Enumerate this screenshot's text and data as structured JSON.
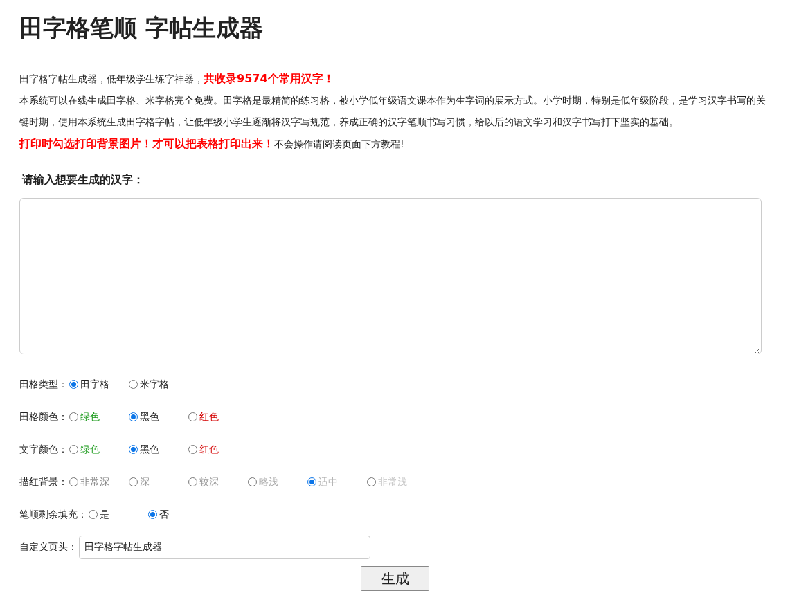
{
  "title": "田字格笔顺 字帖生成器",
  "intro": [
    {
      "parts": [
        {
          "text": "田字格字帖生成器，低年级学生练字神器，",
          "emphasis": false
        },
        {
          "text": "共收录9574个常用汉字！",
          "emphasis": true
        }
      ]
    },
    {
      "parts": [
        {
          "text": "本系统可以在线生成田字格、米字格完全免费。田字格是最精简的练习格，被小学低年级语文课本作为生字词的展示方式。小学时期，特别是低年级阶段，是学习汉字书写的关键时期，使用本系统生成田字格字帖，让低年级小学生逐渐将汉字写规范，养成正确的汉字笔顺书写习惯，给以后的语文学习和汉字书写打下坚实的基础。",
          "emphasis": false
        }
      ]
    },
    {
      "parts": [
        {
          "text": "打印时勾选打印背景图片！才可以把表格打印出来！",
          "emphasis": true
        },
        {
          "text": "不会操作请阅读页面下方教程!",
          "emphasis": false
        }
      ]
    }
  ],
  "input_label": "请输入想要生成的汉字：",
  "option_groups": [
    {
      "label": "田格类型：",
      "options": [
        {
          "label": "田字格",
          "selected": true
        },
        {
          "label": "米字格",
          "selected": false
        }
      ]
    },
    {
      "label": "田格颜色：",
      "options": [
        {
          "label": "绿色",
          "selected": false,
          "color": "#1a9a1a"
        },
        {
          "label": "黑色",
          "selected": true,
          "color": "#222222"
        },
        {
          "label": "红色",
          "selected": false,
          "color": "#d40000"
        }
      ]
    },
    {
      "label": "文字颜色：",
      "options": [
        {
          "label": "绿色",
          "selected": false,
          "color": "#1a9a1a"
        },
        {
          "label": "黑色",
          "selected": true,
          "color": "#222222"
        },
        {
          "label": "红色",
          "selected": false,
          "color": "#d40000"
        }
      ]
    },
    {
      "label": "描红背景：",
      "options": [
        {
          "label": "非常深",
          "selected": false,
          "color": "#888888"
        },
        {
          "label": "深",
          "selected": false,
          "color": "#999999"
        },
        {
          "label": "较深",
          "selected": false,
          "color": "#999999"
        },
        {
          "label": "略浅",
          "selected": false,
          "color": "#aaaaaa"
        },
        {
          "label": "适中",
          "selected": true,
          "color": "#b4b4b4"
        },
        {
          "label": "非常浅",
          "selected": false,
          "color": "#c8c8c8"
        }
      ]
    },
    {
      "label": "笔顺剩余填充：",
      "options": [
        {
          "label": "是",
          "selected": false
        },
        {
          "label": "否",
          "selected": true
        }
      ]
    }
  ],
  "header_field": {
    "label": "自定义页头：",
    "value": "田字格字帖生成器"
  },
  "submit": "生成"
}
